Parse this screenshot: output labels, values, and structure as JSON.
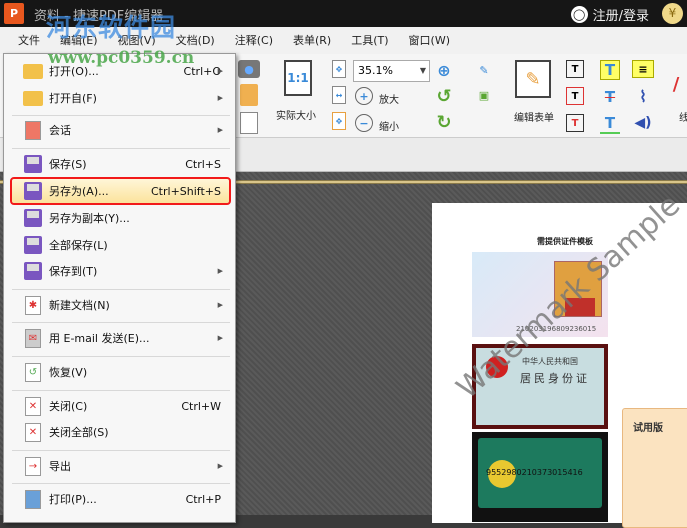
{
  "titlebar": {
    "app_icon": "P",
    "title": "资料 - 捷速PDF编辑器",
    "login": "注册/登录",
    "vip_icon": "¥"
  },
  "watermark": {
    "site_name": "河东软件园",
    "site_url": "www.pc0359.cn"
  },
  "menubar": [
    "文件",
    "编辑(E)",
    "视图(V)",
    "文档(D)",
    "注释(C)",
    "表单(R)",
    "工具(T)",
    "窗口(W)"
  ],
  "toolbar": {
    "actual_size_label": "实际大小",
    "actual_size_icon": "1:1",
    "zoom_value": "35.1%",
    "zoom_in": "放大",
    "zoom_out": "缩小",
    "edit_form": "编辑表单",
    "cut_label": "线"
  },
  "file_menu": [
    {
      "label": "打开(O)...",
      "shortcut": "Ctrl+O",
      "submenu": true,
      "icon": "folder-icon"
    },
    {
      "label": "打开自(F)",
      "shortcut": "",
      "submenu": true,
      "icon": "folder-web-icon"
    },
    {
      "label": "会话",
      "shortcut": "",
      "submenu": true,
      "icon": "session-icon"
    },
    {
      "label": "保存(S)",
      "shortcut": "Ctrl+S",
      "submenu": false,
      "icon": "save-icon"
    },
    {
      "label": "另存为(A)...",
      "shortcut": "Ctrl+Shift+S",
      "submenu": false,
      "icon": "save-as-icon",
      "highlighted": true
    },
    {
      "label": "另存为副本(Y)...",
      "shortcut": "",
      "submenu": false,
      "icon": "save-copy-icon"
    },
    {
      "label": "全部保存(L)",
      "shortcut": "",
      "submenu": false,
      "icon": "save-all-icon"
    },
    {
      "label": "保存到(T)",
      "shortcut": "",
      "submenu": true,
      "icon": "save-to-icon"
    },
    {
      "label": "新建文档(N)",
      "shortcut": "",
      "submenu": true,
      "icon": "new-document-icon"
    },
    {
      "label": "用 E-mail 发送(E)...",
      "shortcut": "",
      "submenu": true,
      "icon": "email-icon"
    },
    {
      "label": "恢复(V)",
      "shortcut": "",
      "submenu": false,
      "icon": "revert-icon"
    },
    {
      "label": "关闭(C)",
      "shortcut": "Ctrl+W",
      "submenu": false,
      "icon": "close-doc-icon"
    },
    {
      "label": "关闭全部(S)",
      "shortcut": "",
      "submenu": false,
      "icon": "close-all-icon"
    },
    {
      "label": "导出",
      "shortcut": "",
      "submenu": true,
      "icon": "export-icon"
    },
    {
      "label": "打印(P)...",
      "shortcut": "Ctrl+P",
      "submenu": false,
      "icon": "print-icon"
    }
  ],
  "document": {
    "page_title": "需提供证件模板",
    "id_number": "210203196809236015",
    "card2_line1": "中华人民共和国",
    "card2_line2": "居民身份证",
    "bank_number": "9552980210373015416",
    "watermark": "Watermark Sample",
    "trial_label": "试用版"
  }
}
